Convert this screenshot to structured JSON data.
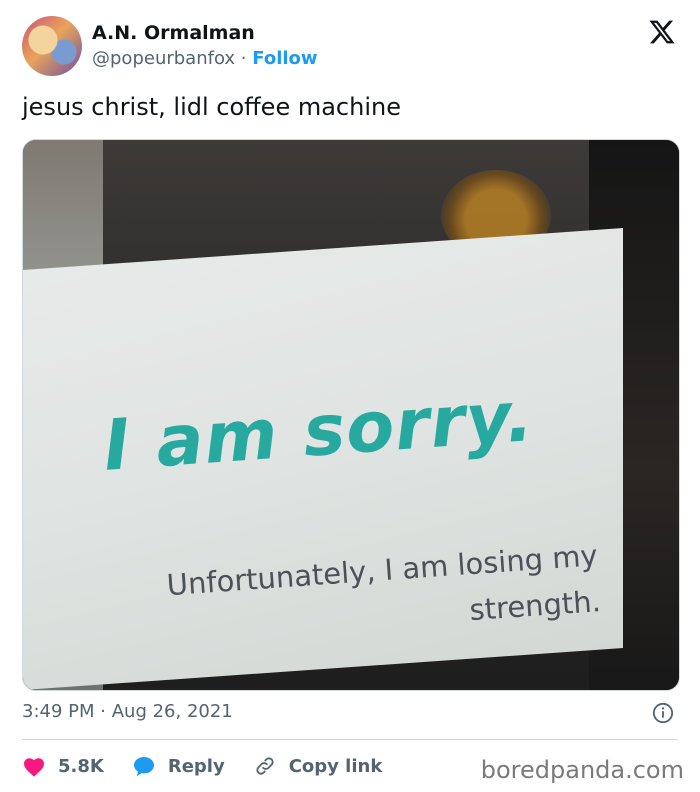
{
  "author": {
    "name": "A.N. Ormalman",
    "handle": "@popeurbanfox",
    "separator": "·",
    "follow_label": "Follow"
  },
  "tweet": {
    "text": "jesus christ, lidl coffee machine",
    "image": {
      "headline": "I am sorry.",
      "subtext": "Unfortunately, I am losing my strength."
    },
    "time": "3:49 PM",
    "date_separator": "·",
    "date": "Aug 26, 2021"
  },
  "actions": {
    "likes": "5.8K",
    "reply_label": "Reply",
    "copy_link_label": "Copy link"
  },
  "watermark": "boredpanda.com",
  "icons": {
    "brand": "x-logo-icon",
    "info": "info-icon",
    "like": "heart-icon",
    "reply": "speech-bubble-icon",
    "link": "link-icon"
  },
  "colors": {
    "like": "#f91880",
    "reply": "#1d9bf0",
    "follow": "#1d9bf0",
    "sorry_text": "#28a9a0"
  }
}
